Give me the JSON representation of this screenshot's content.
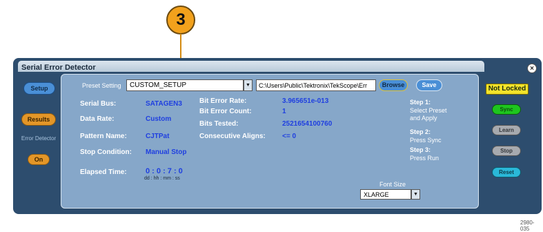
{
  "callout": {
    "number": "3"
  },
  "window": {
    "title": "Serial Error Detector",
    "close_glyph": "×"
  },
  "left_nav": {
    "setup_label": "Setup",
    "results_label": "Results",
    "error_detector_label": "Error Detector",
    "on_label": "On"
  },
  "toolbar": {
    "preset_label": "Preset Setting",
    "preset_value": "CUSTOM_SETUP",
    "dropdown_glyph": "▼",
    "path_value": "C:\\Users\\Public\\Tektronix\\TekScope\\Err",
    "browse_label": "Browse",
    "save_label": "Save"
  },
  "fields": {
    "serial_bus_label": "Serial Bus:",
    "serial_bus_value": "SATAGEN3",
    "data_rate_label": "Data Rate:",
    "data_rate_value": "Custom",
    "pattern_name_label": "Pattern Name:",
    "pattern_name_value": "CJTPat",
    "stop_condition_label": "Stop Condition:",
    "stop_condition_value": "Manual Stop",
    "elapsed_time_label": "Elapsed Time:",
    "elapsed_time_value": "0 : 0 : 7 : 0",
    "elapsed_time_format": "dd : hh : mm : ss"
  },
  "stats": {
    "bit_error_rate_label": "Bit Error Rate:",
    "bit_error_rate_value": "3.965651e-013",
    "bit_error_count_label": "Bit Error Count:",
    "bit_error_count_value": "1",
    "bits_tested_label": "Bits Tested:",
    "bits_tested_value": "2521654100760",
    "consecutive_aligns_label": "Consecutive Aligns:",
    "consecutive_aligns_value": "<= 0"
  },
  "steps": {
    "step1_title": "Step 1:",
    "step1_text": "Select Preset and Apply",
    "step2_title": "Step 2:",
    "step2_text": "Press Sync",
    "step3_title": "Step 3:",
    "step3_text": "Press Run"
  },
  "font_size": {
    "label": "Font Size",
    "value": "XLARGE"
  },
  "right_panel": {
    "status_label": "Not Locked",
    "sync_label": "Sync",
    "learn_label": "Learn",
    "stop_label": "Stop",
    "reset_label": "Reset"
  },
  "figure_code": "2980-035",
  "colors": {
    "panel_bg": "#2d4d6e",
    "inner_bg": "#86a7c9",
    "value_blue": "#1f3fe0",
    "accent_orange": "#e39628",
    "status_yellow": "#f3e32a",
    "sync_green": "#1ec51e"
  }
}
